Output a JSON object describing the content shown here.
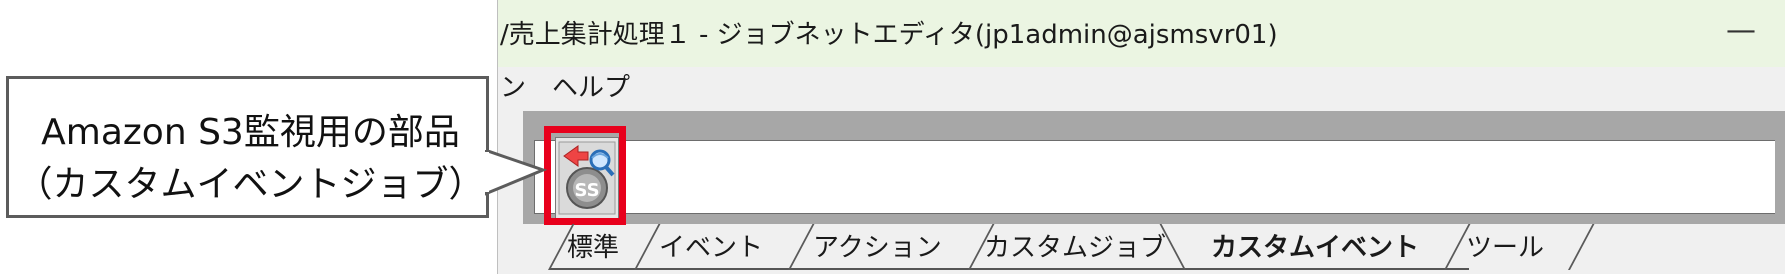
{
  "window": {
    "title": "/売上集計処理１ - ジョブネットエディタ(jp1admin@ajsmsvr01)",
    "minimize_symbol": "—"
  },
  "menubar": {
    "items": [
      {
        "label": "ン"
      },
      {
        "label": "ヘルプ"
      }
    ]
  },
  "palette": {
    "icon": {
      "name": "amazon-s3-monitor-icon",
      "text": "SS"
    }
  },
  "tabs": [
    {
      "label": "標準",
      "active": false
    },
    {
      "label": "イベント",
      "active": false
    },
    {
      "label": "アクション",
      "active": false
    },
    {
      "label": "カスタムジョブ",
      "active": false
    },
    {
      "label": "カスタムイベント",
      "active": true
    },
    {
      "label": "ツール",
      "active": false
    }
  ],
  "callout": {
    "line1": "Amazon S3監視用の部品",
    "line2": "（カスタムイベントジョブ）"
  },
  "colors": {
    "highlight": "#e8001c",
    "titlebar": "#ebf5e2",
    "panel": "#a7a7a7"
  }
}
